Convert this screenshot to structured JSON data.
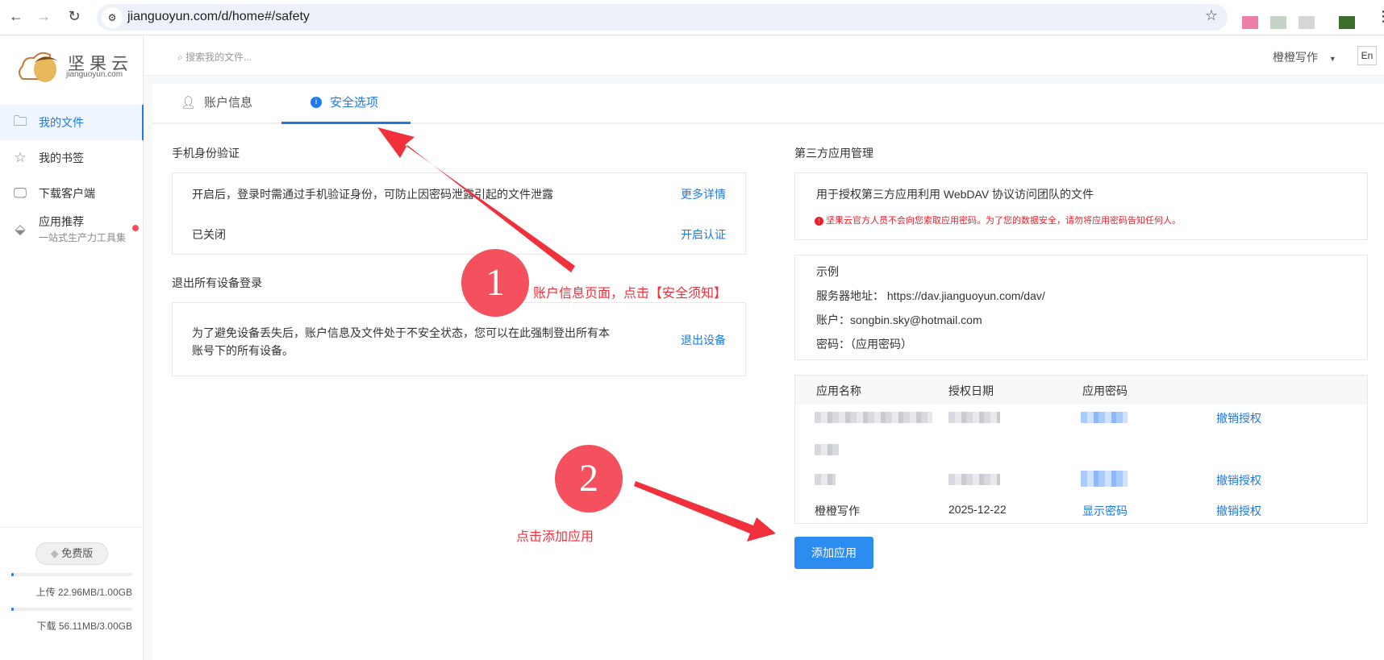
{
  "browser": {
    "url": "jianguoyun.com/d/home#/safety",
    "icons": [
      "back-icon",
      "forward-icon",
      "reload-icon",
      "site-settings-icon",
      "star-icon",
      "menu-icon"
    ]
  },
  "logo": {
    "name": "坚果云",
    "domain": "jianguoyun.com"
  },
  "sidebar": {
    "items": [
      {
        "label": "我的文件",
        "icon": "folder-icon",
        "active": true
      },
      {
        "label": "我的书签",
        "icon": "star-icon"
      },
      {
        "label": "下载客户端",
        "icon": "monitor-icon"
      },
      {
        "label": "应用推荐",
        "sub": "一站式生产力工具集",
        "icon": "tag-icon",
        "badge": true
      }
    ],
    "plan": "免费版",
    "upload": {
      "label": "上传 22.96MB/1.00GB",
      "percent": 2.2
    },
    "download": {
      "label": "下载 56.11MB/3.00GB",
      "percent": 1.8
    }
  },
  "header": {
    "search_placeholder": "搜索我的文件...",
    "user": "橙橙写作",
    "lang": "En"
  },
  "tabs": [
    {
      "label": "账户信息",
      "icon": "user-icon"
    },
    {
      "label": "安全选项",
      "icon": "info-icon",
      "active": true
    }
  ],
  "phone_auth": {
    "title": "手机身份验证",
    "desc": "开启后，登录时需通过手机验证身份，可防止因密码泄露引起的文件泄露",
    "more": "更多详情",
    "status": "已关闭",
    "enable": "开启认证"
  },
  "logout": {
    "title": "退出所有设备登录",
    "desc1": "为了避免设备丢失后，账户信息及文件处于不安全状态，您可以在此强制登出所有本",
    "desc2": "账号下的所有设备。",
    "action": "退出设备"
  },
  "third_party": {
    "title": "第三方应用管理",
    "desc": "用于授权第三方应用利用 WebDAV 协议访问团队的文件",
    "warning": "坚果云官方人员不会向您索取应用密码。为了您的数据安全，请勿将应用密码告知任何人。",
    "example_title": "示例",
    "server": "服务器地址：  https://dav.jianguoyun.com/dav/",
    "account": "账户：songbin.sky@hotmail.com",
    "password": "密码：（应用密码）",
    "columns": [
      "应用名称",
      "授权日期",
      "应用密码"
    ],
    "last_row": {
      "name": "橙橙写作",
      "date": "2025-12-22",
      "password": "显示密码",
      "revoke": "撤销授权"
    },
    "revoke": "撤销授权",
    "add_button": "添加应用"
  },
  "annotations": {
    "step1": "1",
    "text1": "账户信息页面，点击【安全须知】",
    "step2": "2",
    "text2": "点击添加应用",
    "color": "#f4505d"
  }
}
